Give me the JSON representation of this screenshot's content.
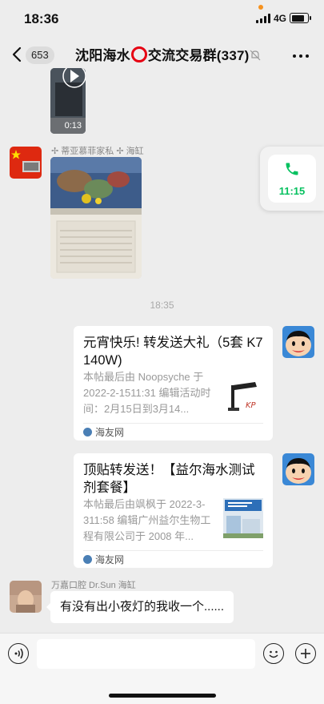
{
  "status": {
    "time": "18:36",
    "network": "4G"
  },
  "nav": {
    "unread_count": "653",
    "title_before": "沈阳海水",
    "title_after": "交流交易群(337)"
  },
  "colors": {
    "wechat_green": "#07c160",
    "chat_background": "#ededed",
    "red_ring": "#e60012"
  },
  "messages": {
    "video": {
      "duration": "0:13"
    },
    "photo_sender": "✢ 蒂亚慕菲家私 ✢ 海缸",
    "time_separator": "18:35",
    "card1": {
      "title": "元宵快乐! 转发送大礼（5套 K7 140W)",
      "desc": "本帖最后由 Noopsyche 于 2022-2-1511:31 编辑活动时间：2月15日到3月14...",
      "source": "海友网"
    },
    "card2": {
      "title": "顶贴转发送！【益尔海水测试剂套餐】",
      "desc": "本帖最后由飒枫于 2022-3-311:58 编辑广州益尔生物工程有限公司于 2008 年...",
      "source": "海友网"
    },
    "last_sender": "万嘉口腔 Dr.Sun 海缸",
    "last_text": "有没有出小夜灯的我收一个......"
  },
  "call_float": {
    "duration": "11:15"
  },
  "input": {
    "placeholder": ""
  },
  "icons": [
    "back-arrow-icon",
    "mute-icon",
    "more-icon",
    "phone-icon",
    "voice-icon",
    "emoji-icon",
    "plus-icon",
    "play-icon"
  ]
}
